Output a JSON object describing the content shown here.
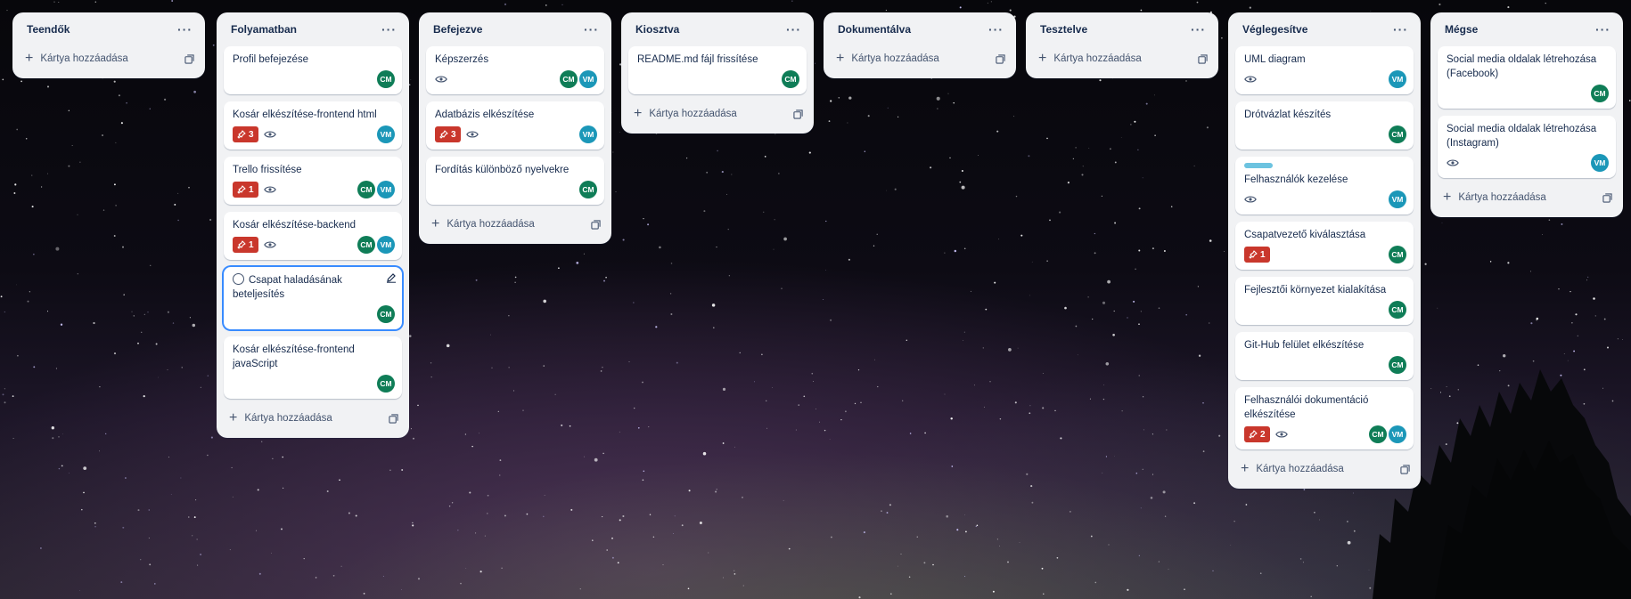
{
  "colors": {
    "list_bg": "#f1f2f4",
    "member_cm": "#0f7d57",
    "member_vm": "#1b97b8",
    "priority_badge": "#c9372c",
    "label_teal": "#6cc3e0",
    "selected_outline": "#388bff"
  },
  "common": {
    "add_card_label": "Kártya hozzáadása",
    "menu_glyph": "···",
    "plus_glyph": "+"
  },
  "lists": [
    {
      "title": "Teendők",
      "cards": []
    },
    {
      "title": "Folyamatban",
      "cards": [
        {
          "title": "Profil befejezése",
          "members": [
            "CM"
          ]
        },
        {
          "title": "Kosár elkészítése-frontend html",
          "badge": "3",
          "watch": true,
          "members": [
            "VM"
          ]
        },
        {
          "title": "Trello frissítése",
          "badge": "1",
          "watch": true,
          "members": [
            "CM",
            "VM"
          ]
        },
        {
          "title": "Kosár elkészítése-backend",
          "badge": "1",
          "watch": true,
          "members": [
            "CM",
            "VM"
          ]
        },
        {
          "title": "Csapat haladásának beteljesítés",
          "members": [
            "CM"
          ],
          "selected": true
        },
        {
          "title": "Kosár elkészítése-frontend javaScript",
          "members": [
            "CM"
          ]
        }
      ]
    },
    {
      "title": "Befejezve",
      "cards": [
        {
          "title": "Képszerzés",
          "watch": true,
          "members": [
            "CM",
            "VM"
          ]
        },
        {
          "title": "Adatbázis elkészítése",
          "badge": "3",
          "watch": true,
          "members": [
            "VM"
          ]
        },
        {
          "title": "Fordítás különböző nyelvekre",
          "members": [
            "CM"
          ]
        }
      ]
    },
    {
      "title": "Kiosztva",
      "cards": [
        {
          "title": "README.md fájl frissítése",
          "members": [
            "CM"
          ]
        }
      ]
    },
    {
      "title": "Dokumentálva",
      "cards": []
    },
    {
      "title": "Tesztelve",
      "cards": []
    },
    {
      "title": "Véglegesítve",
      "cards": [
        {
          "title": "UML diagram",
          "watch": true,
          "members": [
            "VM"
          ]
        },
        {
          "title": "Drótvázlat készítés",
          "members": [
            "CM"
          ]
        },
        {
          "title": "Felhasználók kezelése",
          "label": "teal",
          "watch": true,
          "members": [
            "VM"
          ]
        },
        {
          "title": "Csapatvezető kiválasztása",
          "badge": "1",
          "members": [
            "CM"
          ]
        },
        {
          "title": "Fejlesztői környezet kialakítása",
          "members": [
            "CM"
          ]
        },
        {
          "title": "Git-Hub felület elkészítése",
          "members": [
            "CM"
          ]
        },
        {
          "title": "Felhasználói dokumentáció elkészítése",
          "badge": "2",
          "watch": true,
          "members": [
            "CM",
            "VM"
          ]
        }
      ]
    },
    {
      "title": "Mégse",
      "cards": [
        {
          "title": "Social media oldalak létrehozása (Facebook)",
          "members": [
            "CM"
          ]
        },
        {
          "title": "Social media oldalak létrehozása (Instagram)",
          "watch": true,
          "members": [
            "VM"
          ]
        }
      ]
    }
  ]
}
